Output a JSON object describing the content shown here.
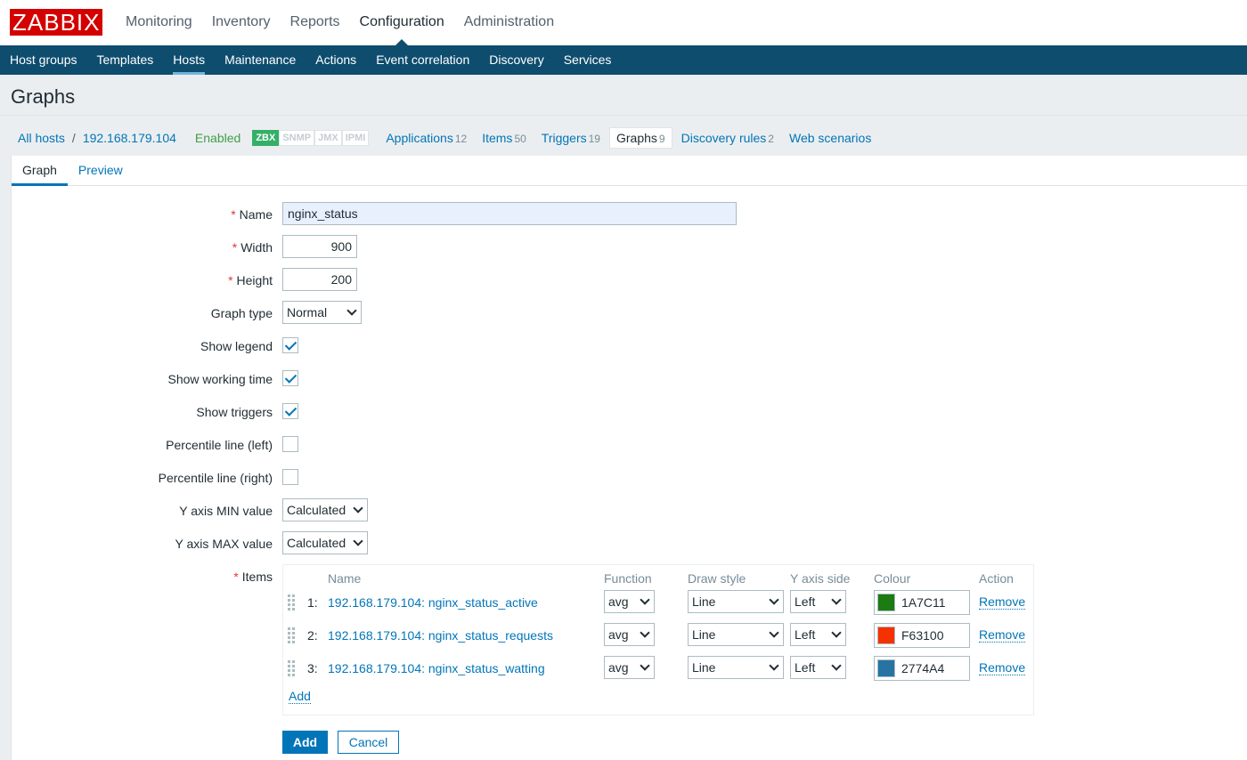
{
  "logo": "ZABBIX",
  "main_menu": [
    "Monitoring",
    "Inventory",
    "Reports",
    "Configuration",
    "Administration"
  ],
  "main_menu_active": "Configuration",
  "sub_menu": [
    "Host groups",
    "Templates",
    "Hosts",
    "Maintenance",
    "Actions",
    "Event correlation",
    "Discovery",
    "Services"
  ],
  "sub_menu_active": "Hosts",
  "page_title": "Graphs",
  "host_nav": {
    "all_hosts": "All hosts",
    "separator": "/",
    "host": "192.168.179.104",
    "status": "Enabled",
    "availability": [
      "ZBX",
      "SNMP",
      "JMX",
      "IPMI"
    ],
    "links": [
      {
        "label": "Applications",
        "count": "12"
      },
      {
        "label": "Items",
        "count": "50"
      },
      {
        "label": "Triggers",
        "count": "19"
      },
      {
        "label": "Graphs",
        "count": "9"
      },
      {
        "label": "Discovery rules",
        "count": "2"
      },
      {
        "label": "Web scenarios",
        "count": ""
      }
    ]
  },
  "tabs": [
    "Graph",
    "Preview"
  ],
  "form": {
    "name_label": "Name",
    "name_value": "nginx_status",
    "width_label": "Width",
    "width_value": "900",
    "height_label": "Height",
    "height_value": "200",
    "graph_type_label": "Graph type",
    "graph_type_value": "Normal",
    "show_legend_label": "Show legend",
    "show_legend": true,
    "show_working_time_label": "Show working time",
    "show_working_time": true,
    "show_triggers_label": "Show triggers",
    "show_triggers": true,
    "percentile_left_label": "Percentile line (left)",
    "percentile_left": false,
    "percentile_right_label": "Percentile line (right)",
    "percentile_right": false,
    "ymin_label": "Y axis MIN value",
    "ymin_value": "Calculated",
    "ymax_label": "Y axis MAX value",
    "ymax_value": "Calculated",
    "items_label": "Items",
    "required_mark": "*"
  },
  "items_table": {
    "headers": [
      "Name",
      "Function",
      "Draw style",
      "Y axis side",
      "Colour",
      "Action"
    ],
    "rows": [
      {
        "num": "1:",
        "name": "192.168.179.104: nginx_status_active",
        "function": "avg",
        "draw_style": "Line",
        "y_axis_side": "Left",
        "colour": "1A7C11",
        "colour_hex": "#1A7C11",
        "action": "Remove"
      },
      {
        "num": "2:",
        "name": "192.168.179.104: nginx_status_requests",
        "function": "avg",
        "draw_style": "Line",
        "y_axis_side": "Left",
        "colour": "F63100",
        "colour_hex": "#F63100",
        "action": "Remove"
      },
      {
        "num": "3:",
        "name": "192.168.179.104: nginx_status_watting",
        "function": "avg",
        "draw_style": "Line",
        "y_axis_side": "Left",
        "colour": "2774A4",
        "colour_hex": "#2774A4",
        "action": "Remove"
      }
    ],
    "add": "Add"
  },
  "buttons": {
    "add": "Add",
    "cancel": "Cancel"
  }
}
